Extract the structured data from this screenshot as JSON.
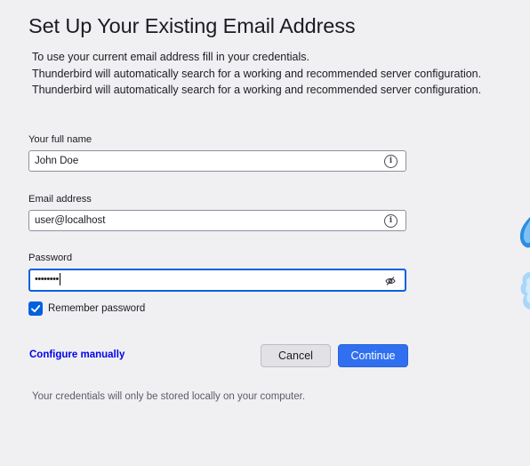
{
  "heading": "Set Up Your Existing Email Address",
  "intro": {
    "line1": "To use your current email address fill in your credentials.",
    "line2": "Thunderbird will automatically search for a working and recommended server configuration.",
    "line3": "Thunderbird will automatically search for a working and recommended server configuration."
  },
  "form": {
    "name_label": "Your full name",
    "name_value": "John Doe",
    "email_label": "Email address",
    "email_value": "user@localhost",
    "password_label": "Password",
    "password_value": "••••••••",
    "remember_label": "Remember password",
    "remember_checked": true
  },
  "actions": {
    "configure_manually": "Configure manually",
    "cancel": "Cancel",
    "continue": "Continue"
  },
  "footnote": "Your credentials will only be stored locally on your computer.",
  "icons": {
    "name_info": "info-icon",
    "email_info": "info-icon",
    "password_toggle": "eye-slash-icon",
    "checkbox": "checkmark-icon"
  },
  "colors": {
    "accent": "#0061e0",
    "primary_button": "#3070f0",
    "link": "#0000ee",
    "background": "#f0f0f3"
  }
}
